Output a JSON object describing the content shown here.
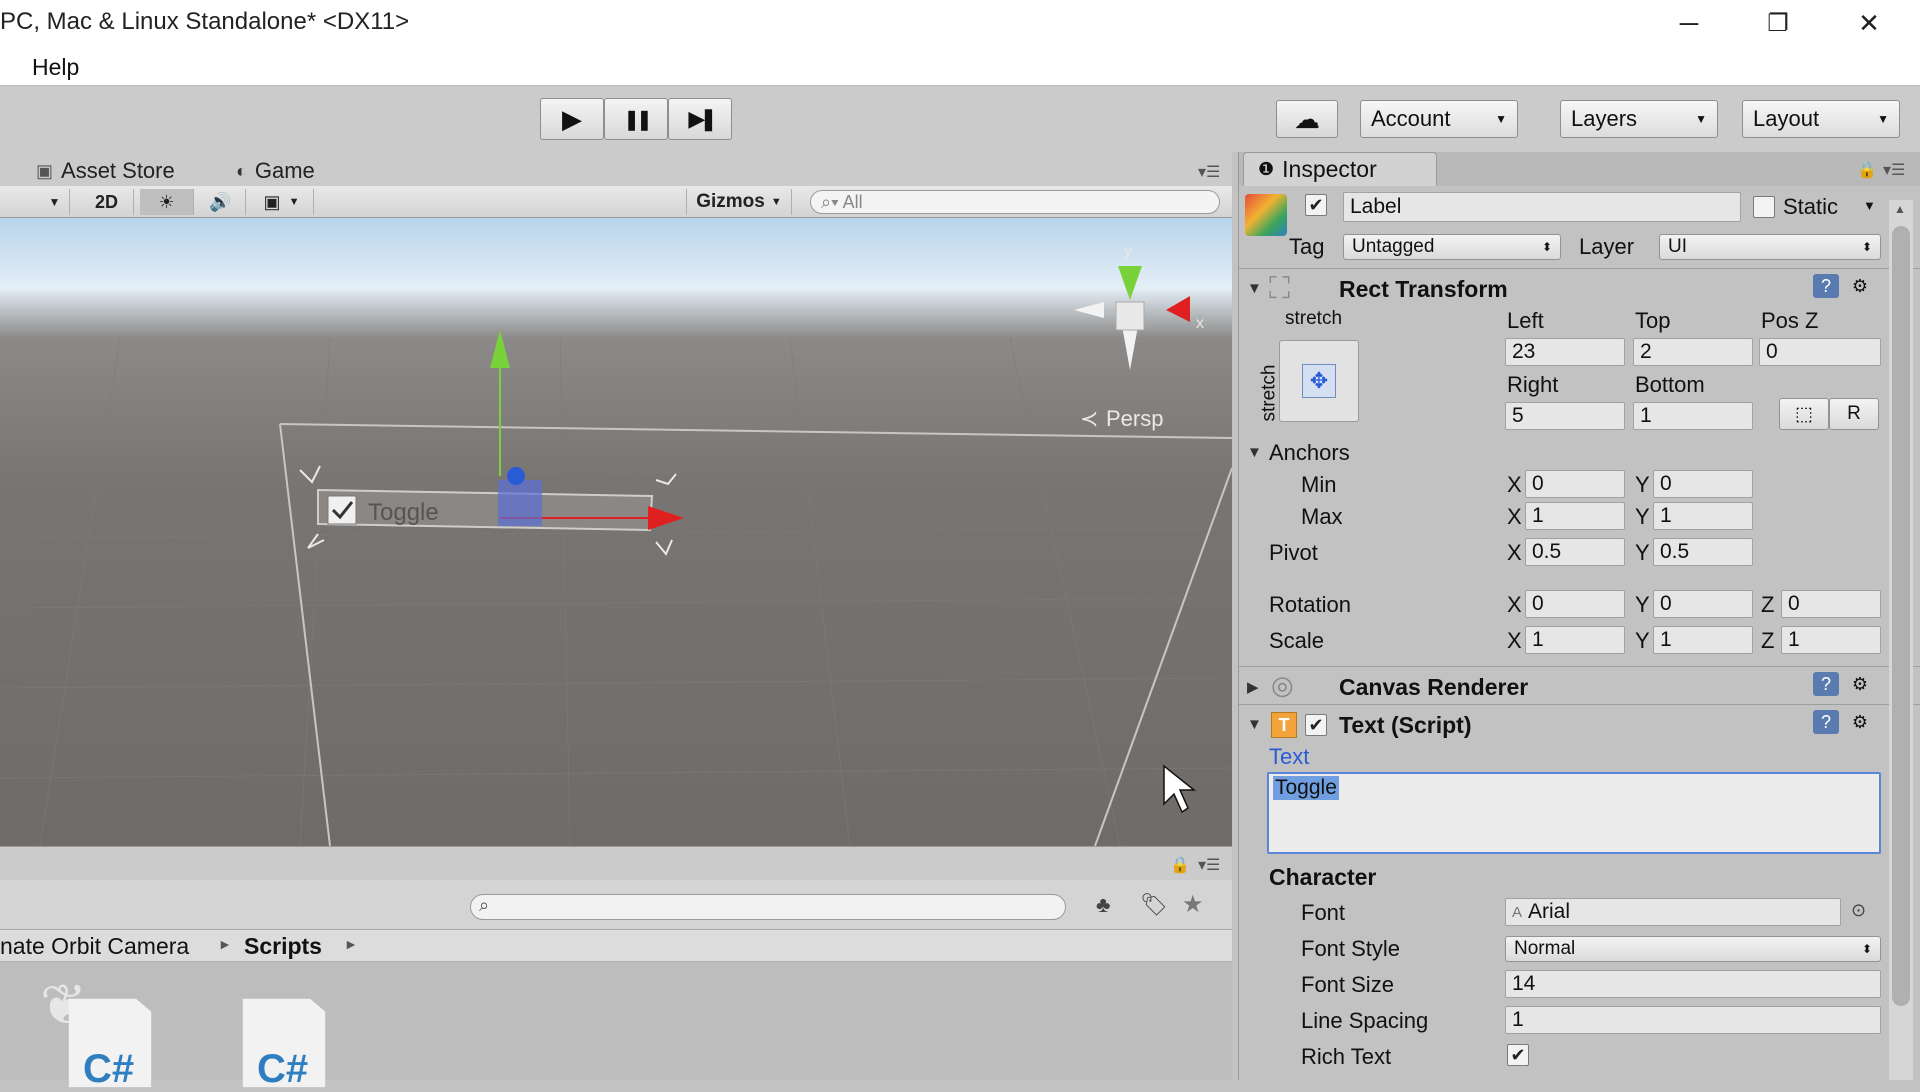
{
  "window": {
    "title": "PC, Mac & Linux Standalone* <DX11>",
    "minimize": "─",
    "restore": "❐",
    "close": "✕"
  },
  "menu": {
    "items": [
      "Help"
    ]
  },
  "toolbar": {
    "play": "▶",
    "pause": "❚❚",
    "step": "▶❚",
    "cloud": "☁",
    "account": "Account",
    "layers": "Layers",
    "layout": "Layout"
  },
  "scene": {
    "tabs": [
      "Asset Store",
      "Game"
    ],
    "mode_2d": "2D",
    "gizmos": "Gizmos",
    "search_placeholder": "All",
    "persp": "Persp",
    "gizmo_axis_y": "y",
    "gizmo_axis_x": "x",
    "toggle_label": "Toggle"
  },
  "project": {
    "breadcrumb": [
      "nate Orbit Camera",
      "Scripts"
    ],
    "files": [
      "C#",
      "C#"
    ]
  },
  "inspector": {
    "tab": "Inspector",
    "object": {
      "name": "Label",
      "active": true,
      "static_label": "Static",
      "tag_label": "Tag",
      "tag": "Untagged",
      "layer_label": "Layer",
      "layer": "UI"
    },
    "rect_transform": {
      "title": "Rect Transform",
      "anchor_preset_h": "stretch",
      "anchor_preset_v": "stretch",
      "left_label": "Left",
      "left": "23",
      "top_label": "Top",
      "top": "2",
      "posz_label": "Pos Z",
      "posz": "0",
      "right_label": "Right",
      "right": "5",
      "bottom_label": "Bottom",
      "bottom": "1",
      "raw_edit": "R",
      "anchors_label": "Anchors",
      "min_label": "Min",
      "min_x": "0",
      "min_y": "0",
      "max_label": "Max",
      "max_x": "1",
      "max_y": "1",
      "pivot_label": "Pivot",
      "pivot_x": "0.5",
      "pivot_y": "0.5",
      "rotation_label": "Rotation",
      "rot_x": "0",
      "rot_y": "0",
      "rot_z": "0",
      "scale_label": "Scale",
      "scale_x": "1",
      "scale_y": "1",
      "scale_z": "1",
      "x": "X",
      "y": "Y",
      "z": "Z"
    },
    "canvas_renderer": {
      "title": "Canvas Renderer"
    },
    "text_script": {
      "title": "Text (Script)",
      "text_label": "Text",
      "text_value": "Toggle",
      "character_label": "Character",
      "font_label": "Font",
      "font": "Arial",
      "font_style_label": "Font Style",
      "font_style": "Normal",
      "font_size_label": "Font Size",
      "font_size": "14",
      "line_spacing_label": "Line Spacing",
      "line_spacing": "1",
      "rich_text_label": "Rich Text",
      "rich_text": true
    }
  },
  "colors": {
    "accent_blue": "#2a5bd7",
    "selection": "#6f9fe0",
    "gizmo_red": "#e02020",
    "gizmo_green": "#7ad23a"
  }
}
